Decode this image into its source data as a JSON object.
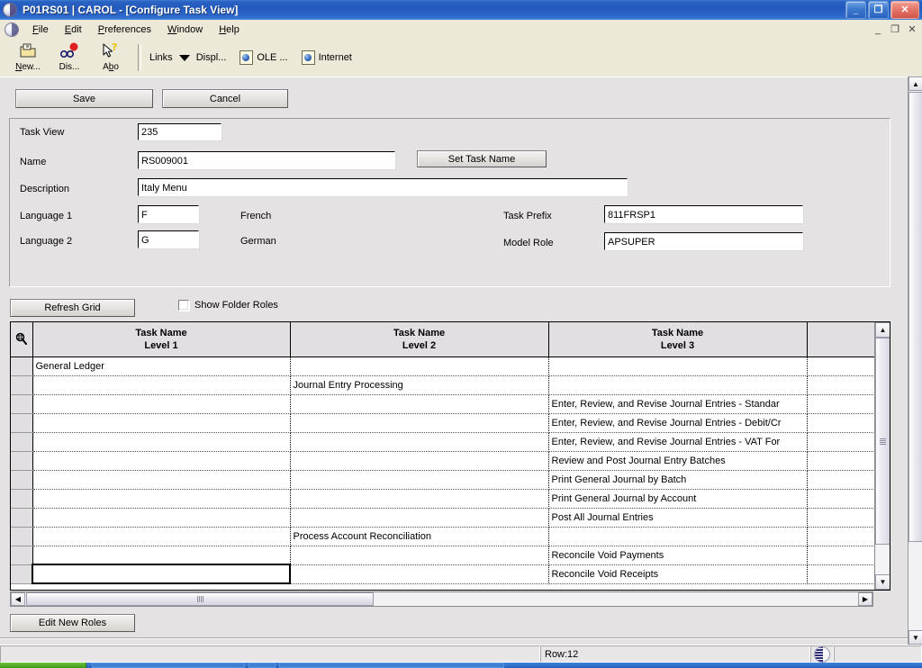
{
  "window": {
    "title": "P01RS01 | CAROL  - [Configure Task View]",
    "minimize_label": "_",
    "maximize_label": "❐",
    "close_label": "✕",
    "mdi_minimize": "_",
    "mdi_restore": "❐",
    "mdi_close": "✕"
  },
  "menubar": {
    "items": [
      {
        "label": "File",
        "accel": "F"
      },
      {
        "label": "Edit",
        "accel": "E"
      },
      {
        "label": "Preferences",
        "accel": "P"
      },
      {
        "label": "Window",
        "accel": "W"
      },
      {
        "label": "Help",
        "accel": "H"
      }
    ]
  },
  "toolbar": {
    "buttons": [
      {
        "label": "New...",
        "icon": "new-folder-icon"
      },
      {
        "label": "Dis...",
        "icon": "glasses-balloon-icon"
      },
      {
        "label": "Abo",
        "icon": "cursor-help-icon"
      }
    ],
    "links_label": "Links",
    "display_label": "Displ...",
    "ole_label": "OLE ...",
    "internet_label": "Internet"
  },
  "form": {
    "save_label": "Save",
    "cancel_label": "Cancel",
    "set_task_name_label": "Set Task Name",
    "fields": {
      "task_view": {
        "label": "Task View",
        "value": "235"
      },
      "name": {
        "label": "Name",
        "value": "RS009001"
      },
      "description": {
        "label": "Description",
        "value": "Italy Menu"
      },
      "language1": {
        "label": "Language 1",
        "value": "F",
        "description": "French"
      },
      "language2": {
        "label": "Language 2",
        "value": "G",
        "description": "German"
      },
      "task_prefix": {
        "label": "Task Prefix",
        "value": "811FRSP1"
      },
      "model_role": {
        "label": "Model Role",
        "value": "APSUPER"
      }
    }
  },
  "grid_toolbar": {
    "refresh_label": "Refresh Grid",
    "show_folder_roles_label": "Show Folder Roles",
    "show_folder_roles_checked": false
  },
  "grid": {
    "row_selector_icon": "magnifier-icon",
    "columns": [
      {
        "line1": "Task Name",
        "line2": "Level 1"
      },
      {
        "line1": "Task Name",
        "line2": "Level 2"
      },
      {
        "line1": "Task Name",
        "line2": "Level 3"
      },
      {
        "line1": "",
        "line2": ""
      }
    ],
    "rows": [
      {
        "level1": "General Ledger",
        "level2": "",
        "level3": "",
        "level4": "",
        "selected": false
      },
      {
        "level1": "",
        "level2": "Journal Entry Processing",
        "level3": "",
        "level4": "",
        "selected": false
      },
      {
        "level1": "",
        "level2": "",
        "level3": "Enter, Review, and Revise Journal Entries - Standar",
        "level4": "",
        "selected": false
      },
      {
        "level1": "",
        "level2": "",
        "level3": "Enter, Review, and Revise Journal Entries - Debit/Cr",
        "level4": "",
        "selected": false
      },
      {
        "level1": "",
        "level2": "",
        "level3": "Enter, Review, and Revise Journal Entries - VAT For",
        "level4": "",
        "selected": false
      },
      {
        "level1": "",
        "level2": "",
        "level3": "Review and Post Journal Entry Batches",
        "level4": "",
        "selected": false
      },
      {
        "level1": "",
        "level2": "",
        "level3": "Print General Journal by Batch",
        "level4": "",
        "selected": false
      },
      {
        "level1": "",
        "level2": "",
        "level3": "Print General Journal by Account",
        "level4": "",
        "selected": false
      },
      {
        "level1": "",
        "level2": "",
        "level3": "Post All Journal Entries",
        "level4": "",
        "selected": false
      },
      {
        "level1": "",
        "level2": "Process Account Reconciliation",
        "level3": "",
        "level4": "",
        "selected": false
      },
      {
        "level1": "",
        "level2": "",
        "level3": "Reconcile Void Payments",
        "level4": "",
        "selected": false
      },
      {
        "level1": "",
        "level2": "",
        "level3": "Reconcile Void Receipts",
        "level4": "",
        "selected": true
      }
    ]
  },
  "footer": {
    "edit_new_roles_label": "Edit New Roles"
  },
  "statusbar": {
    "row_label": "Row:12",
    "globe_icon": "globe-icon"
  },
  "scrollbars": {
    "up_arrow": "▲",
    "down_arrow": "▼",
    "left_arrow": "◀",
    "right_arrow": "▶"
  }
}
